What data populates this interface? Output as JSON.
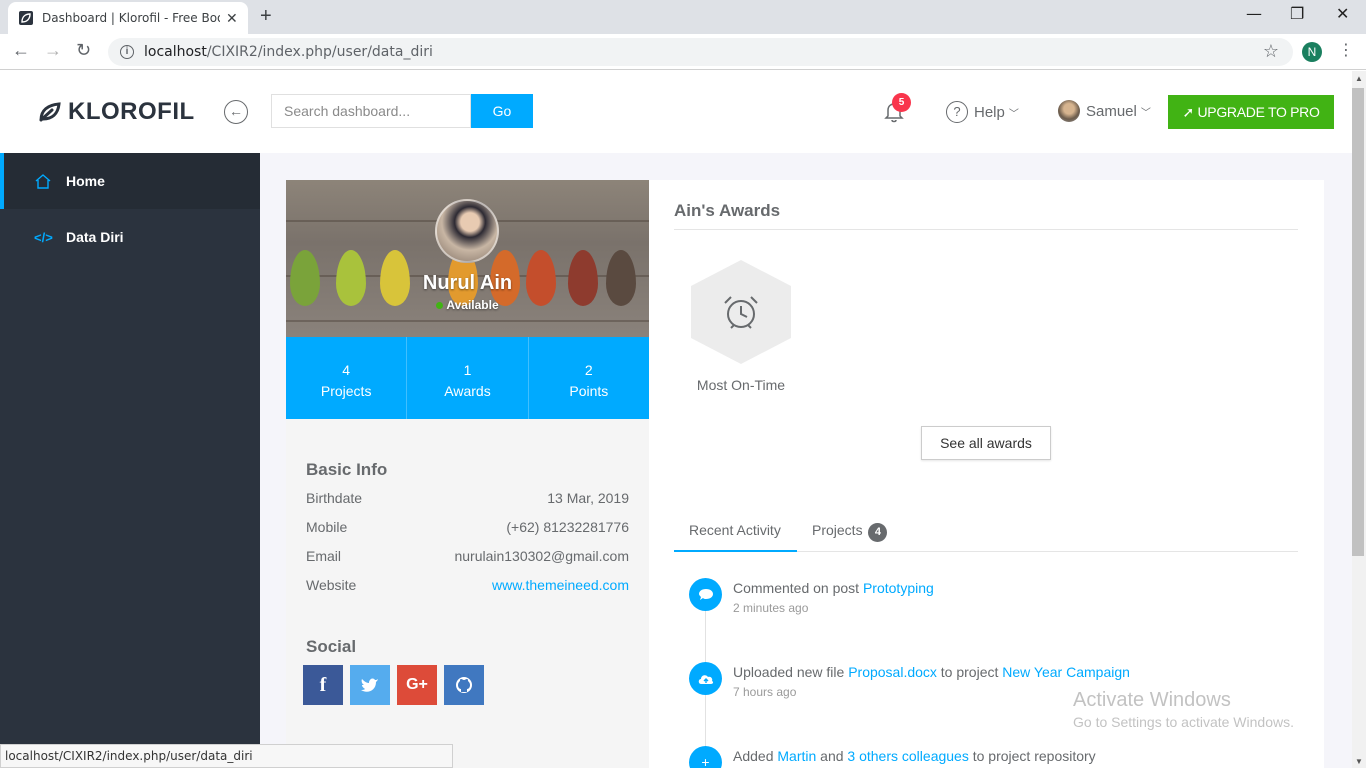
{
  "browser": {
    "tab_title": "Dashboard | Klorofil - Free Bootstrap Dashboard Template",
    "tab_close": "✕",
    "new_tab": "+",
    "url_host": "localhost",
    "url_path": "/CIXIR2/index.php/user/data_diri",
    "profile_initial": "N",
    "status_url": "localhost/CIXIR2/index.php/user/data_diri"
  },
  "navbar": {
    "brand": "KLOROFIL",
    "search_placeholder": "Search dashboard...",
    "go_label": "Go",
    "notification_count": "5",
    "help_label": "Help",
    "user_name": "Samuel",
    "upgrade_label": "UPGRADE TO PRO"
  },
  "sidebar": {
    "items": [
      {
        "label": "Home",
        "icon": "home-icon",
        "active": true
      },
      {
        "label": "Data Diri",
        "icon": "code-icon",
        "active": false
      }
    ]
  },
  "profile": {
    "name": "Nurul Ain",
    "status": "Available",
    "stats": [
      {
        "value": "4",
        "label": "Projects"
      },
      {
        "value": "1",
        "label": "Awards"
      },
      {
        "value": "2",
        "label": "Points"
      }
    ],
    "basic_info_title": "Basic Info",
    "basic_info": [
      {
        "label": "Birthdate",
        "value": "13 Mar, 2019"
      },
      {
        "label": "Mobile",
        "value": "(+62) 81232281776"
      },
      {
        "label": "Email",
        "value": "nurulain130302@gmail.com"
      },
      {
        "label": "Website",
        "value": "www.themeineed.com"
      }
    ],
    "social_title": "Social",
    "social": [
      {
        "name": "facebook",
        "glyph": "f",
        "color": "#3b5998"
      },
      {
        "name": "twitter",
        "glyph": "t",
        "color": "#55acee"
      },
      {
        "name": "google-plus",
        "glyph": "G+",
        "color": "#dd4b39"
      },
      {
        "name": "github",
        "glyph": "gh",
        "color": "#4078c0"
      }
    ]
  },
  "awards": {
    "title": "Ain's Awards",
    "items": [
      {
        "label": "Most On-Time",
        "icon": "alarm-clock-icon"
      }
    ],
    "see_all_label": "See all awards"
  },
  "activity": {
    "tabs": [
      {
        "label": "Recent Activity",
        "active": true
      },
      {
        "label": "Projects",
        "count": "4",
        "active": false
      }
    ],
    "items": [
      {
        "icon": "comment-icon",
        "pre": "Commented on post ",
        "link": "Prototyping",
        "mid": "",
        "link2": "",
        "post": "",
        "time": "2 minutes ago"
      },
      {
        "icon": "cloud-upload-icon",
        "pre": "Uploaded new file ",
        "link": "Proposal.docx",
        "mid": " to project ",
        "link2": "New Year Campaign",
        "post": "",
        "time": "7 hours ago"
      },
      {
        "icon": "plus-icon",
        "pre": "Added ",
        "link": "Martin",
        "mid": " and ",
        "link2": "3 others colleagues",
        "post": " to project repository",
        "time": ""
      }
    ]
  },
  "watermark": {
    "line1": "Activate Windows",
    "line2": "Go to Settings to activate Windows."
  },
  "colors": {
    "accent": "#00aaff",
    "sidebar": "#2b333e",
    "upgrade": "#41b314",
    "badge": "#f9354c"
  }
}
